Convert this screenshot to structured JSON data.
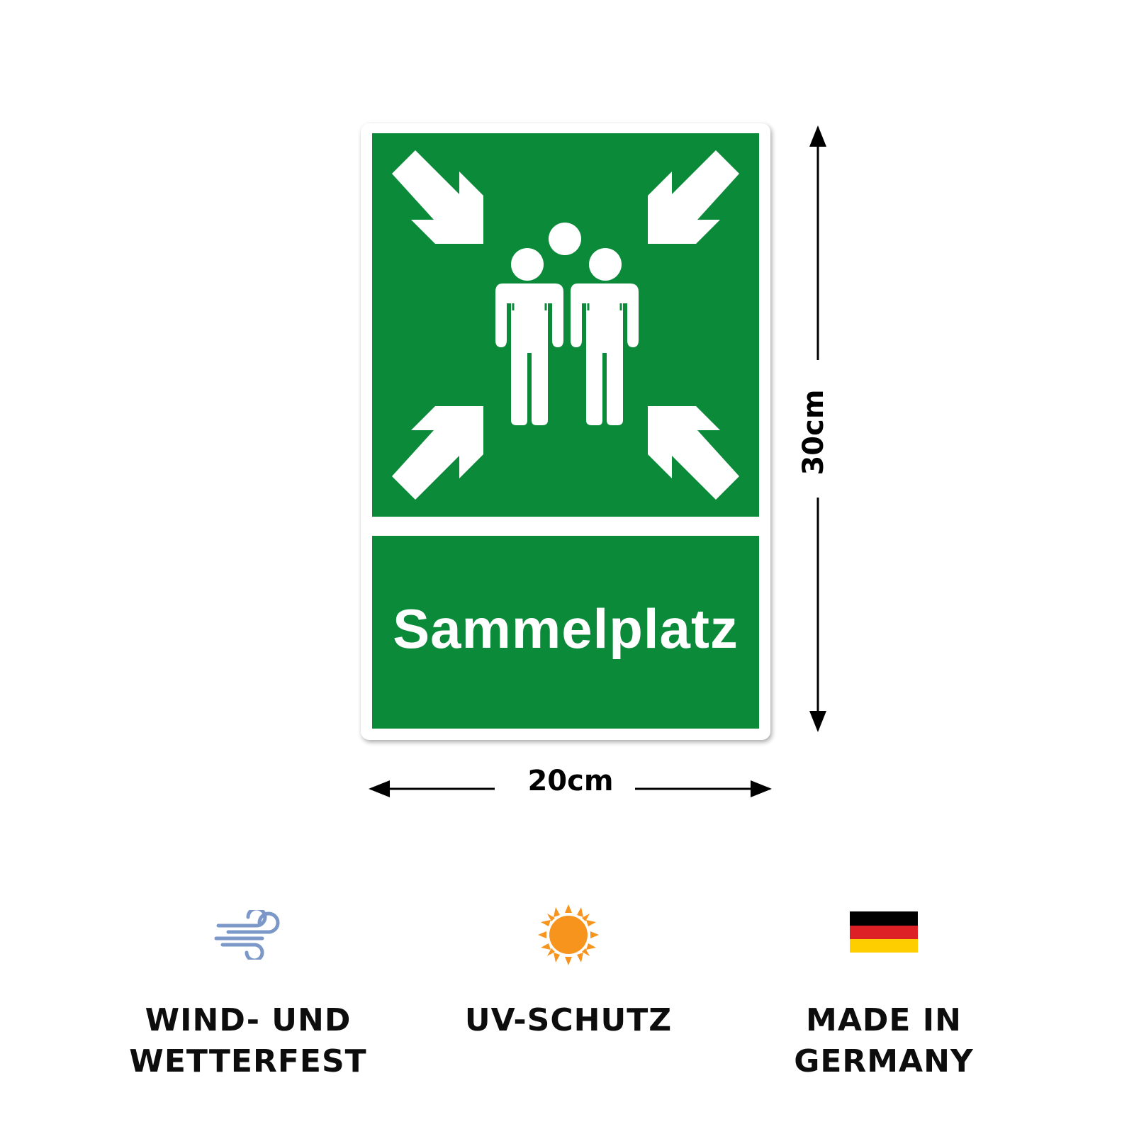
{
  "sign": {
    "label": "Sammelplatz",
    "pictogram": "assembly-point-pictogram",
    "colors": {
      "green": "#0b8a3a",
      "white": "#ffffff"
    }
  },
  "dimensions": {
    "width_label": "20cm",
    "height_label": "30cm"
  },
  "features": [
    {
      "icon": "wind-icon",
      "label_line1": "WIND- UND",
      "label_line2": "WETTERFEST"
    },
    {
      "icon": "sun-icon",
      "label_line1": "UV-SCHUTZ",
      "label_line2": ""
    },
    {
      "icon": "germany-flag-icon",
      "label_line1": "MADE IN",
      "label_line2": "GERMANY"
    }
  ],
  "icon_colors": {
    "wind": "#7b98c9",
    "sun": "#f7941d",
    "flag": [
      "#000000",
      "#dd1f26",
      "#ffce00"
    ]
  }
}
